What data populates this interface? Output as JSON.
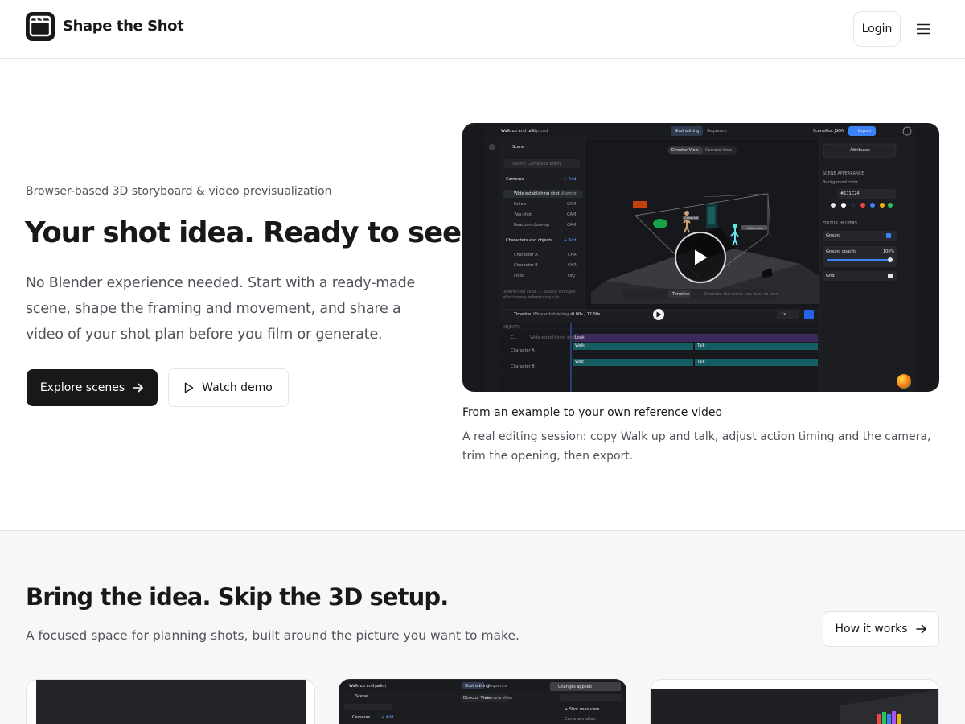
{
  "header": {
    "brand": "Shape the Shot",
    "login_label": "Login"
  },
  "hero": {
    "eyebrow": "Browser-based 3D storyboard & video previsualization",
    "title": "Your shot idea. Ready to see.",
    "description": "No Blender experience needed. Start with a ready-made scene, shape the framing and movement, and share a video of your shot plan before you film or generate.",
    "primary_button": "Explore scenes",
    "secondary_button": "Watch demo"
  },
  "video": {
    "caption_title": "From an example to your own reference video",
    "caption_description": "A real editing session: copy Walk up and talk, adjust action timing and the camera, trim the opening, then export.",
    "ui": {
      "scene_name": "Walk up and talk",
      "sync_status": "Synced",
      "tab_shot_editing": "Shot editing",
      "tab_sequence": "Sequence",
      "scenedoc": "SceneDoc JSON",
      "export": "Export",
      "scene_label": "Scene",
      "search_placeholder": "Search Camera or Entity",
      "cameras_label": "Cameras",
      "add_label": "+ Add",
      "cameras": [
        {
          "name": "Wide establishing shot",
          "tag": "Viewing"
        },
        {
          "name": "Follow",
          "tag": "CAM"
        },
        {
          "name": "Two-shot",
          "tag": "CAM"
        },
        {
          "name": "Reaction close-up",
          "tag": "CAM"
        }
      ],
      "characters_label": "Characters and objects",
      "characters": [
        {
          "name": "Character A",
          "tag": "CHR"
        },
        {
          "name": "Character B",
          "tag": "CHR"
        },
        {
          "name": "Floor",
          "tag": "OBJ"
        }
      ],
      "referenced_note": "Referenced clips: 1. Source changes affect every referencing clip.",
      "director_view": "Director View",
      "camera_view": "Camera View",
      "attributes": "Attributes",
      "scene_appearance": "SCENE APPEARANCE",
      "background_color_label": "Background color",
      "background_color": "#171C24",
      "editor_helpers": "EDITOR HELPERS",
      "ground": "Ground",
      "ground_opacity": "Ground opacity",
      "ground_opacity_value": "100%",
      "grid": "Grid",
      "timeline_label": "Timeline",
      "timeline_clip": "Wide establishing s...",
      "timeline_time": "0.00s / 12.00s",
      "speed": "1x",
      "objects_label": "OBJECTS",
      "camera_row": "C...",
      "camera_row_clip": "Wide establishing shot",
      "track_a": "Character A",
      "track_b": "Character B",
      "clip_look": "Look",
      "clip_walk": "Walk",
      "clip_talk": "Talk",
      "clip_wait": "Wait",
      "timeline_button": "Timeline",
      "describe_placeholder": "Describe the scene you want to start",
      "label_callout_a": "Camera A",
      "label_callout_b": "Follow Cam"
    }
  },
  "section2": {
    "title": "Bring the idea. Skip the 3D setup.",
    "description": "A focused space for planning shots, built around the picture you want to make.",
    "how_button": "How it works"
  },
  "cards": {
    "card2": {
      "scene_name": "Walk up and talk",
      "sync_status": "Synced",
      "tab_shot_editing": "Shot editing",
      "tab_sequence": "Sequence",
      "scene_label": "Scene",
      "director_view": "Director View",
      "camera_view": "Camera View",
      "cameras_label": "Cameras",
      "add_label": "+ Add",
      "changes_applied": "Changes applied",
      "panel_item": "+ Shot uses view",
      "panel_item2": "Camera motion"
    }
  },
  "colors": {
    "ink": "#18181b",
    "muted": "#52525b",
    "border": "#e4e4e7",
    "video_bg": "#18191c",
    "accent_blue": "#3b82f6",
    "track_teal": "#155e63"
  }
}
